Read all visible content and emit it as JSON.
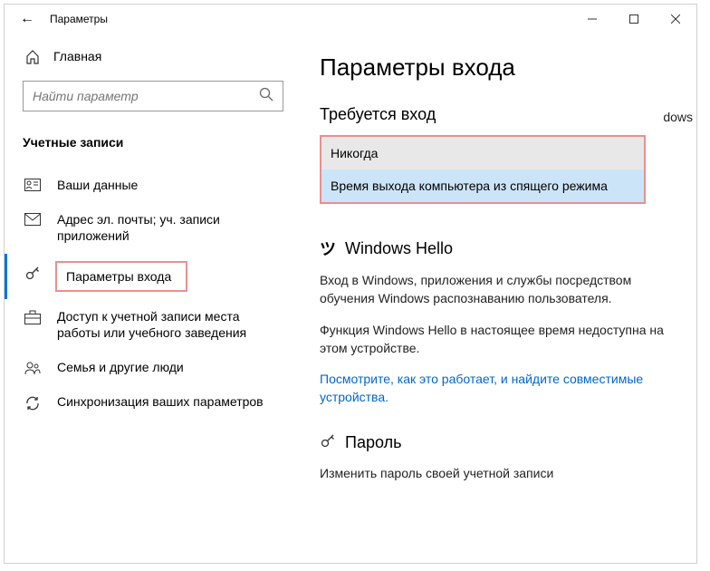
{
  "titlebar": {
    "back": "←",
    "title": "Параметры"
  },
  "sidebar": {
    "home": "Главная",
    "search_placeholder": "Найти параметр",
    "section": "Учетные записи",
    "items": [
      {
        "label": "Ваши данные"
      },
      {
        "label": "Адрес эл. почты; уч. записи приложений"
      },
      {
        "label": "Параметры входа"
      },
      {
        "label": "Доступ к учетной записи места работы или учебного заведения"
      },
      {
        "label": "Семья и другие люди"
      },
      {
        "label": "Синхронизация ваших параметров"
      }
    ]
  },
  "main": {
    "h1": "Параметры входа",
    "signin_required": {
      "heading": "Требуется вход",
      "trail": "dows",
      "options": [
        "Никогда",
        "Время выхода компьютера из спящего режима"
      ]
    },
    "hello": {
      "heading": "Windows Hello",
      "desc": "Вход в Windows, приложения и службы посредством обучения Windows распознаванию пользователя.",
      "unavailable": "Функция Windows Hello в настоящее время недоступна на этом устройстве.",
      "link": "Посмотрите, как это работает, и найдите совместимые устройства."
    },
    "password": {
      "heading": "Пароль",
      "desc": "Изменить пароль своей учетной записи"
    }
  }
}
